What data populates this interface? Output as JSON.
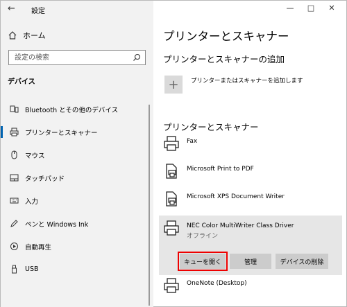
{
  "window": {
    "title": "設定"
  },
  "sidebar": {
    "home": "ホーム",
    "search_placeholder": "設定の検索",
    "section": "デバイス",
    "items": [
      {
        "label": "Bluetooth とその他のデバイス",
        "icon": "bluetooth-device-icon"
      },
      {
        "label": "プリンターとスキャナー",
        "icon": "printer-icon",
        "active": true
      },
      {
        "label": "マウス",
        "icon": "mouse-icon"
      },
      {
        "label": "タッチパッド",
        "icon": "touchpad-icon"
      },
      {
        "label": "入力",
        "icon": "keyboard-icon"
      },
      {
        "label": "ペンと Windows Ink",
        "icon": "pen-icon"
      },
      {
        "label": "自動再生",
        "icon": "autoplay-icon"
      },
      {
        "label": "USB",
        "icon": "usb-icon"
      }
    ]
  },
  "main": {
    "page_title": "プリンターとスキャナー",
    "add_heading": "プリンターとスキャナーの追加",
    "add_label": "プリンターまたはスキャナーを追加します",
    "list_heading": "プリンターとスキャナー",
    "printers": [
      {
        "name": "Fax",
        "status": ""
      },
      {
        "name": "Microsoft Print to PDF",
        "status": ""
      },
      {
        "name": "Microsoft XPS Document Writer",
        "status": ""
      },
      {
        "name": "NEC Color MultiWriter Class Driver",
        "status": "オフライン",
        "selected": true
      },
      {
        "name": "OneNote (Desktop)",
        "status": ""
      }
    ],
    "actions": {
      "open_queue": "キューを開く",
      "manage": "管理",
      "remove": "デバイスの削除"
    }
  },
  "colors": {
    "accent": "#0063b1",
    "highlight": "#ff0000",
    "sidebar_bg": "#f2f2f2"
  }
}
